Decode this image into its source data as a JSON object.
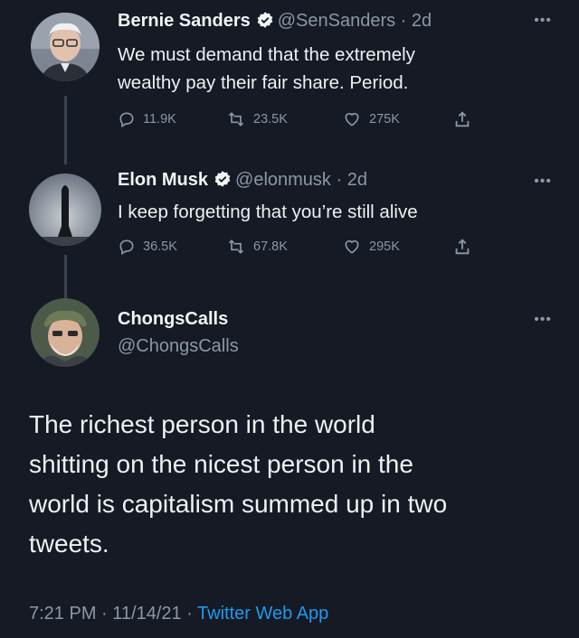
{
  "tweets": [
    {
      "name": "Bernie Sanders",
      "handle": "@SenSanders",
      "time": "2d",
      "text_lines": [
        "We must demand that the extremely",
        "wealthy pay their fair share. Period."
      ],
      "replies": "11.9K",
      "retweets": "23.5K",
      "likes": "275K"
    },
    {
      "name": "Elon Musk",
      "handle": "@elonmusk",
      "time": "2d",
      "text_lines": [
        "I keep forgetting that you’re still alive"
      ],
      "replies": "36.5K",
      "retweets": "67.8K",
      "likes": "295K"
    }
  ],
  "main_tweet": {
    "name": "ChongsCalls",
    "handle": "@ChongsCalls",
    "text_lines": [
      "The richest person in the world",
      "shitting on the nicest person in the",
      "world is capitalism summed up in two",
      "tweets."
    ],
    "timestamp": "7:21 PM · 11/14/21 · ",
    "source": "Twitter Web App"
  },
  "icons": {
    "more": "more-horizontal-icon",
    "reply": "reply-icon",
    "retweet": "retweet-icon",
    "like": "heart-icon",
    "share": "share-icon",
    "verified": "verified-badge-icon"
  },
  "colors": {
    "background": "#151a24",
    "accent": "#1d9bf0",
    "muted": "#8b98a5"
  }
}
